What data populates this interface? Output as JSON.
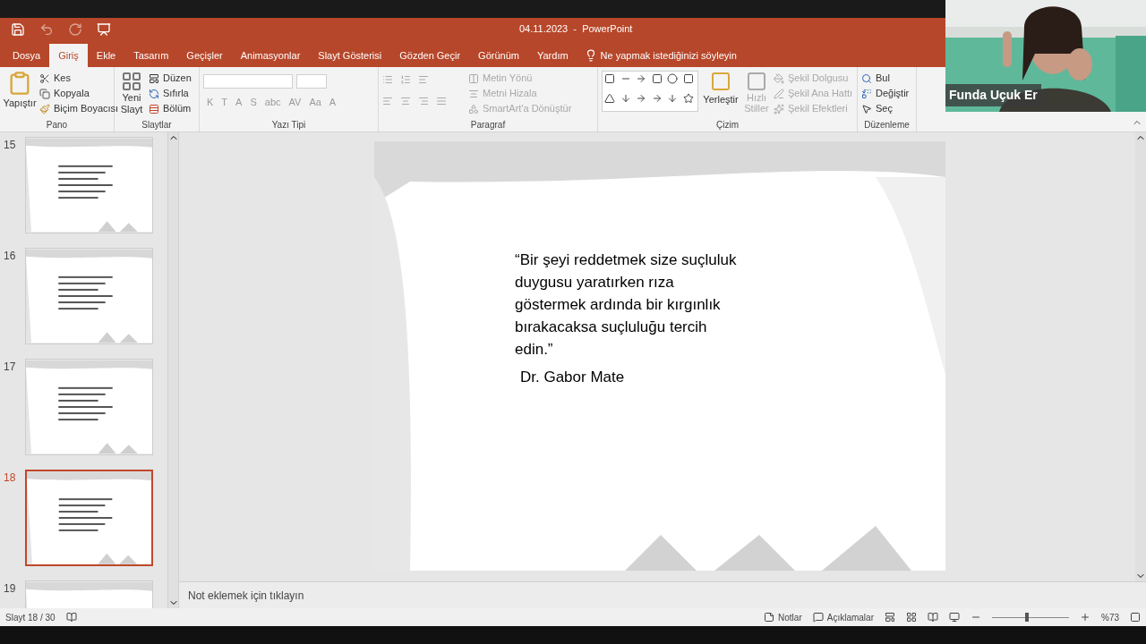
{
  "window": {
    "title": "04.11.2023  -  PowerPoint"
  },
  "tabs": [
    {
      "label": "Dosya",
      "selected": false
    },
    {
      "label": "Giriş",
      "selected": true
    },
    {
      "label": "Ekle",
      "selected": false
    },
    {
      "label": "Tasarım",
      "selected": false
    },
    {
      "label": "Geçişler",
      "selected": false
    },
    {
      "label": "Animasyonlar",
      "selected": false
    },
    {
      "label": "Slayt Gösterisi",
      "selected": false
    },
    {
      "label": "Gözden Geçir",
      "selected": false
    },
    {
      "label": "Görünüm",
      "selected": false
    },
    {
      "label": "Yardım",
      "selected": false
    }
  ],
  "tell_me": "Ne yapmak istediğinizi söyleyin",
  "ribbon": {
    "pano": {
      "paste": "Yapıştır",
      "items": [
        "Kes",
        "Kopyala",
        "Biçim Boyacısı"
      ],
      "label": "Pano"
    },
    "slaytlar": {
      "new": [
        "Yeni",
        "Slayt"
      ],
      "items": [
        "Düzen",
        "Sıfırla",
        "Bölüm"
      ],
      "label": "Slaytlar"
    },
    "yazi_tipi": {
      "label": "Yazı Tipi",
      "buttons": [
        "K",
        "T",
        "A",
        "S",
        "abc",
        "AV",
        "Aa",
        "A"
      ]
    },
    "paragraf": {
      "label": "Paragraf",
      "items": [
        "Metin Yönü",
        "Metni Hizala",
        "SmartArt'a Dönüştür"
      ]
    },
    "cizim": {
      "label": "Çizim",
      "arrange": "Yerleştir",
      "quick": [
        "Hızlı",
        "Stiller"
      ],
      "items": [
        "Şekil Dolgusu",
        "Şekil Ana Hattı",
        "Şekil Efektleri"
      ]
    },
    "duzenleme": {
      "label": "Düzenleme",
      "items": [
        "Bul",
        "Değiştir",
        "Seç"
      ]
    }
  },
  "video": {
    "name": "Funda Uçuk Er"
  },
  "slides": [
    {
      "number": "15",
      "selected": false
    },
    {
      "number": "16",
      "selected": false
    },
    {
      "number": "17",
      "selected": false
    },
    {
      "number": "18",
      "selected": true
    },
    {
      "number": "19",
      "selected": false
    }
  ],
  "slide": {
    "quote": [
      "“Bir şeyi reddetmek size suçluluk",
      "duygusu yaratırken rıza",
      "göstermek ardında bir kırgınlık",
      "bırakacaksa suçluluğu tercih",
      "edin.”"
    ],
    "author": "Dr. Gabor Mate"
  },
  "notes_placeholder": "Not eklemek için tıklayın",
  "status_bar": {
    "slide": "Slayt 18 / 30",
    "notes": "Notlar",
    "comments": "Açıklamalar",
    "zoom": "%73",
    "zoom_slider": {
      "level": 0.45
    }
  }
}
